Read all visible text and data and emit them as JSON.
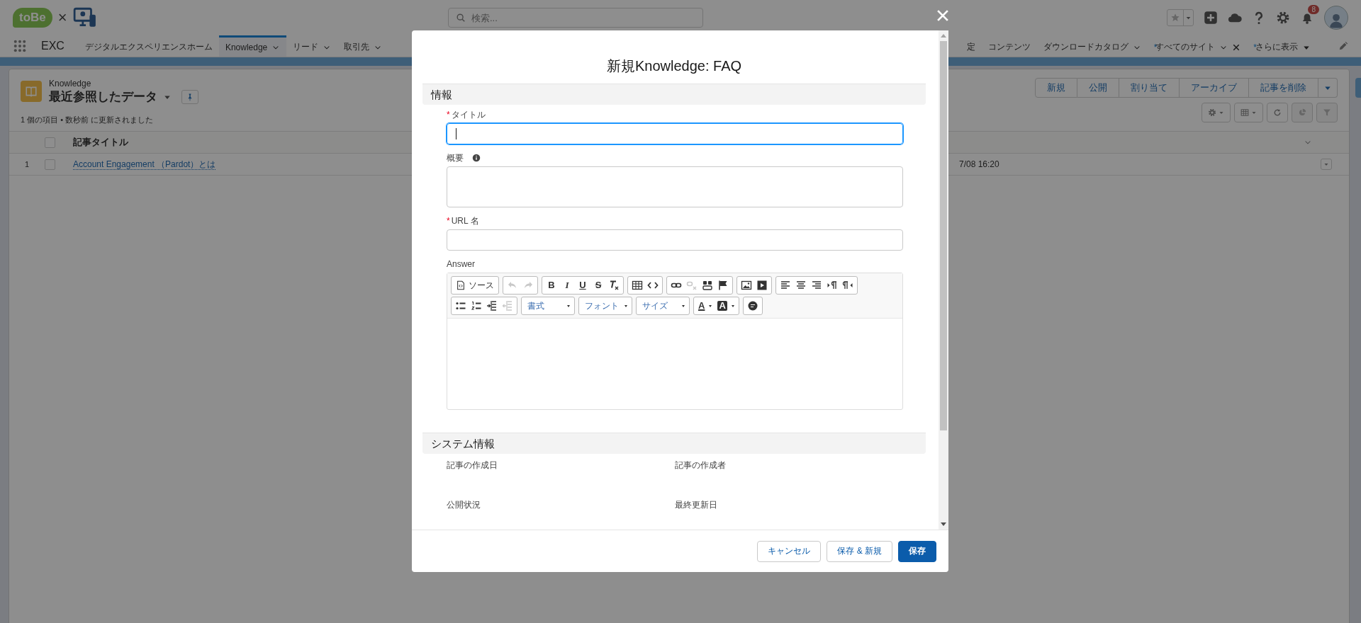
{
  "header": {
    "logo_text": "toBe",
    "logo_separator": "×",
    "search": {
      "placeholder": "検索..."
    },
    "notification_count": "8"
  },
  "nav": {
    "app_name": "EXC",
    "tabs": [
      {
        "label": "デジタルエクスペリエンスホーム",
        "selected": false,
        "menu": false
      },
      {
        "label": "Knowledge",
        "selected": true,
        "menu": true
      },
      {
        "label": "リード",
        "selected": false,
        "menu": true
      },
      {
        "label": "取引先",
        "selected": false,
        "menu": true
      }
    ],
    "tabs_right": [
      {
        "label": "定",
        "menu": false,
        "closable": false
      },
      {
        "label": "コンテンツ",
        "menu": false,
        "closable": false
      },
      {
        "label": "ダウンロードカタログ",
        "menu": true,
        "closable": false
      },
      {
        "prefix": "*",
        "label": "すべてのサイト",
        "menu": true,
        "closable": true
      }
    ],
    "more": {
      "prefix": "*",
      "label": "さらに表示"
    }
  },
  "list_view": {
    "object_label": "Knowledge",
    "title": "最近参照したデータ",
    "status": "1 個の項目 • 数秒前 に更新されました",
    "actions": [
      "新規",
      "公開",
      "割り当て",
      "アーカイブ",
      "記事を削除"
    ],
    "header_checked": false,
    "columns": [
      {
        "label": "記事タイトル"
      }
    ],
    "rows": [
      {
        "number": "1",
        "checked": false,
        "title": "Account Engagement （Pardot）とは",
        "column_2": "7/08 16:20"
      }
    ]
  },
  "modal": {
    "title": "新規Knowledge: FAQ",
    "sections": [
      {
        "heading": "情報",
        "fields": [
          {
            "kind": "input",
            "required_mark": "*",
            "label": "タイトル",
            "focused": true
          },
          {
            "kind": "textarea",
            "label": "概要",
            "info": true,
            "focused": false
          },
          {
            "kind": "input",
            "required_mark": "*",
            "label": "URL 名",
            "focused": false
          },
          {
            "kind": "editor",
            "label": "Answer",
            "focused": false,
            "toolbar": [
              [
                [
                  {
                    "kind": "label",
                    "text": "ソース",
                    "disabled": false
                  }
                ],
                [
                  {
                    "kind": "icon",
                    "disabled": true
                  },
                  {
                    "kind": "icon",
                    "disabled": true
                  }
                ],
                [
                  {
                    "kind": "bold",
                    "text": "B",
                    "disabled": false
                  },
                  {
                    "kind": "italic",
                    "text": "I",
                    "disabled": false
                  },
                  {
                    "kind": "underline",
                    "text": "U",
                    "disabled": false
                  },
                  {
                    "kind": "strike",
                    "text": "S",
                    "disabled": false
                  },
                  {
                    "kind": "icon",
                    "disabled": false
                  }
                ],
                [
                  {
                    "kind": "icon",
                    "disabled": false
                  },
                  {
                    "kind": "icon",
                    "disabled": false
                  }
                ],
                [
                  {
                    "kind": "icon",
                    "disabled": false
                  },
                  {
                    "kind": "icon",
                    "disabled": true
                  },
                  {
                    "kind": "icon",
                    "disabled": false
                  },
                  {
                    "kind": "icon",
                    "disabled": false
                  }
                ],
                [
                  {
                    "kind": "icon",
                    "disabled": false
                  },
                  {
                    "kind": "icon",
                    "disabled": false
                  }
                ],
                [
                  {
                    "kind": "icon",
                    "disabled": false
                  },
                  {
                    "kind": "icon",
                    "disabled": false
                  },
                  {
                    "kind": "icon",
                    "disabled": false
                  },
                  {
                    "kind": "icon",
                    "disabled": false
                  },
                  {
                    "kind": "icon",
                    "disabled": false
                  }
                ]
              ],
              [
                [
                  {
                    "kind": "icon",
                    "disabled": false
                  },
                  {
                    "kind": "icon",
                    "disabled": false
                  },
                  {
                    "kind": "icon",
                    "disabled": false
                  },
                  {
                    "kind": "icon",
                    "disabled": true
                  }
                ],
                [
                  {
                    "kind": "combo",
                    "text": "書式",
                    "disabled": false
                  }
                ],
                [
                  {
                    "kind": "combo",
                    "text": "フォント",
                    "disabled": false
                  }
                ],
                [
                  {
                    "kind": "combo",
                    "text": "サイズ",
                    "disabled": false
                  }
                ],
                [
                  {
                    "kind": "textcolor",
                    "text": "A",
                    "disabled": false
                  },
                  {
                    "kind": "bgcolor",
                    "text": "A",
                    "disabled": false
                  }
                ],
                [
                  {
                    "kind": "icon",
                    "disabled": false
                  }
                ]
              ]
            ]
          }
        ]
      },
      {
        "heading": "システム情報",
        "fields": [
          {
            "kind": "readonly",
            "label": "記事の作成日"
          },
          {
            "kind": "readonly",
            "label": "記事の作成者"
          },
          {
            "kind": "readonly",
            "label": "公開状況"
          },
          {
            "kind": "readonly",
            "label": "最終更新日"
          }
        ]
      }
    ],
    "buttons": [
      {
        "label": "キャンセル",
        "primary": false
      },
      {
        "label": "保存 & 新規",
        "primary": false
      },
      {
        "label": "保存",
        "primary": true
      }
    ]
  }
}
